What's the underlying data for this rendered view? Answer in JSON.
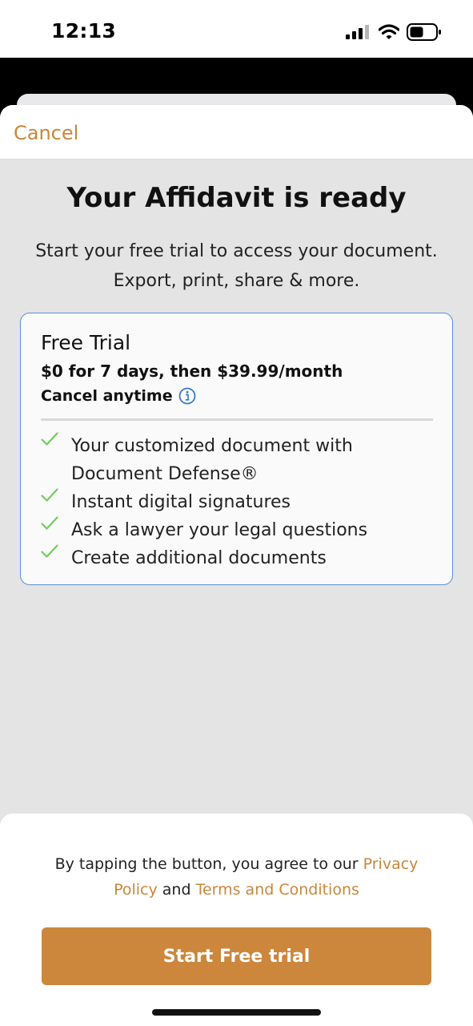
{
  "status_bar": {
    "time": "12:13",
    "signal_icon": "cellular-signal-icon",
    "wifi_icon": "wifi-icon",
    "battery_icon": "battery-icon"
  },
  "nav": {
    "cancel_label": "Cancel"
  },
  "header": {
    "title": "Your Affidavit is ready",
    "subtitle_line1": "Start your free trial to access your document.",
    "subtitle_line2": "Export, print, share & more."
  },
  "plan": {
    "name": "Free Trial",
    "price": "$0 for 7 days, then $39.99/month",
    "cancel_note": "Cancel anytime",
    "info_icon": "info-icon",
    "features": [
      "Your customized document with Document Defense®",
      "Instant digital signatures",
      "Ask a lawyer your legal questions",
      "Create additional documents"
    ]
  },
  "footer": {
    "terms_prefix": "By tapping the button, you agree to our ",
    "privacy_link": "Privacy Policy",
    "terms_and": " and ",
    "terms_link": "Terms and Conditions",
    "cta_label": "Start Free trial"
  },
  "colors": {
    "accent": "#C8873C",
    "button": "#CC873C",
    "check": "#6FCF5A",
    "card_border": "#5B8FD6",
    "sheet_bg": "#E4E4E4"
  }
}
